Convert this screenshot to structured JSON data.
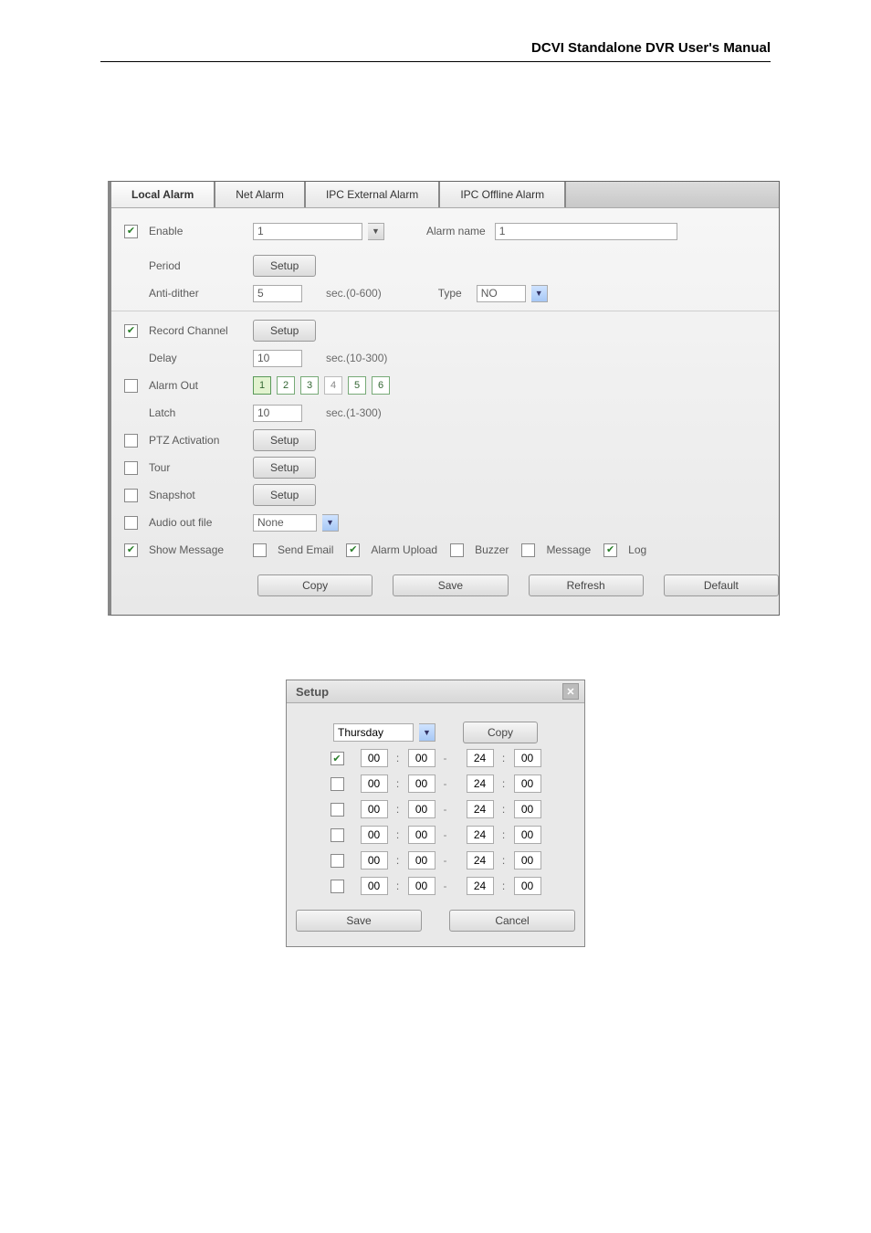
{
  "doc_header": "DCVI Standalone DVR User's Manual",
  "alarm_form": {
    "tabs": [
      "Local Alarm",
      "Net Alarm",
      "IPC External Alarm",
      "IPC Offline Alarm"
    ],
    "active_tab": 0,
    "enable": {
      "label": "Enable",
      "checked": true
    },
    "channel_select": "1",
    "alarm_name_label": "Alarm name",
    "alarm_name_value": "1",
    "period": {
      "label": "Period",
      "button": "Setup"
    },
    "anti_dither": {
      "label": "Anti-dither",
      "value": "5",
      "unit": "sec.(0-600)"
    },
    "type_label": "Type",
    "type_value": "NO",
    "record_channel": {
      "label": "Record Channel",
      "checked": true,
      "button": "Setup"
    },
    "delay": {
      "label": "Delay",
      "value": "10",
      "unit": "sec.(10-300)"
    },
    "alarm_out": {
      "label": "Alarm Out",
      "checked": false,
      "channels": [
        "1",
        "2",
        "3",
        "4",
        "5",
        "6"
      ],
      "active": [
        0,
        1,
        2,
        4,
        5
      ]
    },
    "latch": {
      "label": "Latch",
      "value": "10",
      "unit": "sec.(1-300)"
    },
    "ptz": {
      "label": "PTZ Activation",
      "checked": false,
      "button": "Setup"
    },
    "tour": {
      "label": "Tour",
      "checked": false,
      "button": "Setup"
    },
    "snapshot": {
      "label": "Snapshot",
      "checked": false,
      "button": "Setup"
    },
    "audio_out": {
      "label": "Audio out file",
      "checked": false,
      "value": "None"
    },
    "show_message": {
      "label": "Show Message",
      "checked": true
    },
    "inline_opts": {
      "send_email": {
        "label": "Send Email",
        "checked": false
      },
      "alarm_upload": {
        "label": "Alarm Upload",
        "checked": true
      },
      "buzzer": {
        "label": "Buzzer",
        "checked": false
      },
      "message": {
        "label": "Message",
        "checked": false
      },
      "log": {
        "label": "Log",
        "checked": true
      }
    },
    "buttons": {
      "copy": "Copy",
      "save": "Save",
      "refresh": "Refresh",
      "default": "Default"
    }
  },
  "setup_modal": {
    "title": "Setup",
    "day_select": "Thursday",
    "copy_btn": "Copy",
    "rows": [
      {
        "checked": true,
        "from_h": "00",
        "from_m": "00",
        "to_h": "24",
        "to_m": "00"
      },
      {
        "checked": false,
        "from_h": "00",
        "from_m": "00",
        "to_h": "24",
        "to_m": "00"
      },
      {
        "checked": false,
        "from_h": "00",
        "from_m": "00",
        "to_h": "24",
        "to_m": "00"
      },
      {
        "checked": false,
        "from_h": "00",
        "from_m": "00",
        "to_h": "24",
        "to_m": "00"
      },
      {
        "checked": false,
        "from_h": "00",
        "from_m": "00",
        "to_h": "24",
        "to_m": "00"
      },
      {
        "checked": false,
        "from_h": "00",
        "from_m": "00",
        "to_h": "24",
        "to_m": "00"
      }
    ],
    "save": "Save",
    "cancel": "Cancel"
  }
}
